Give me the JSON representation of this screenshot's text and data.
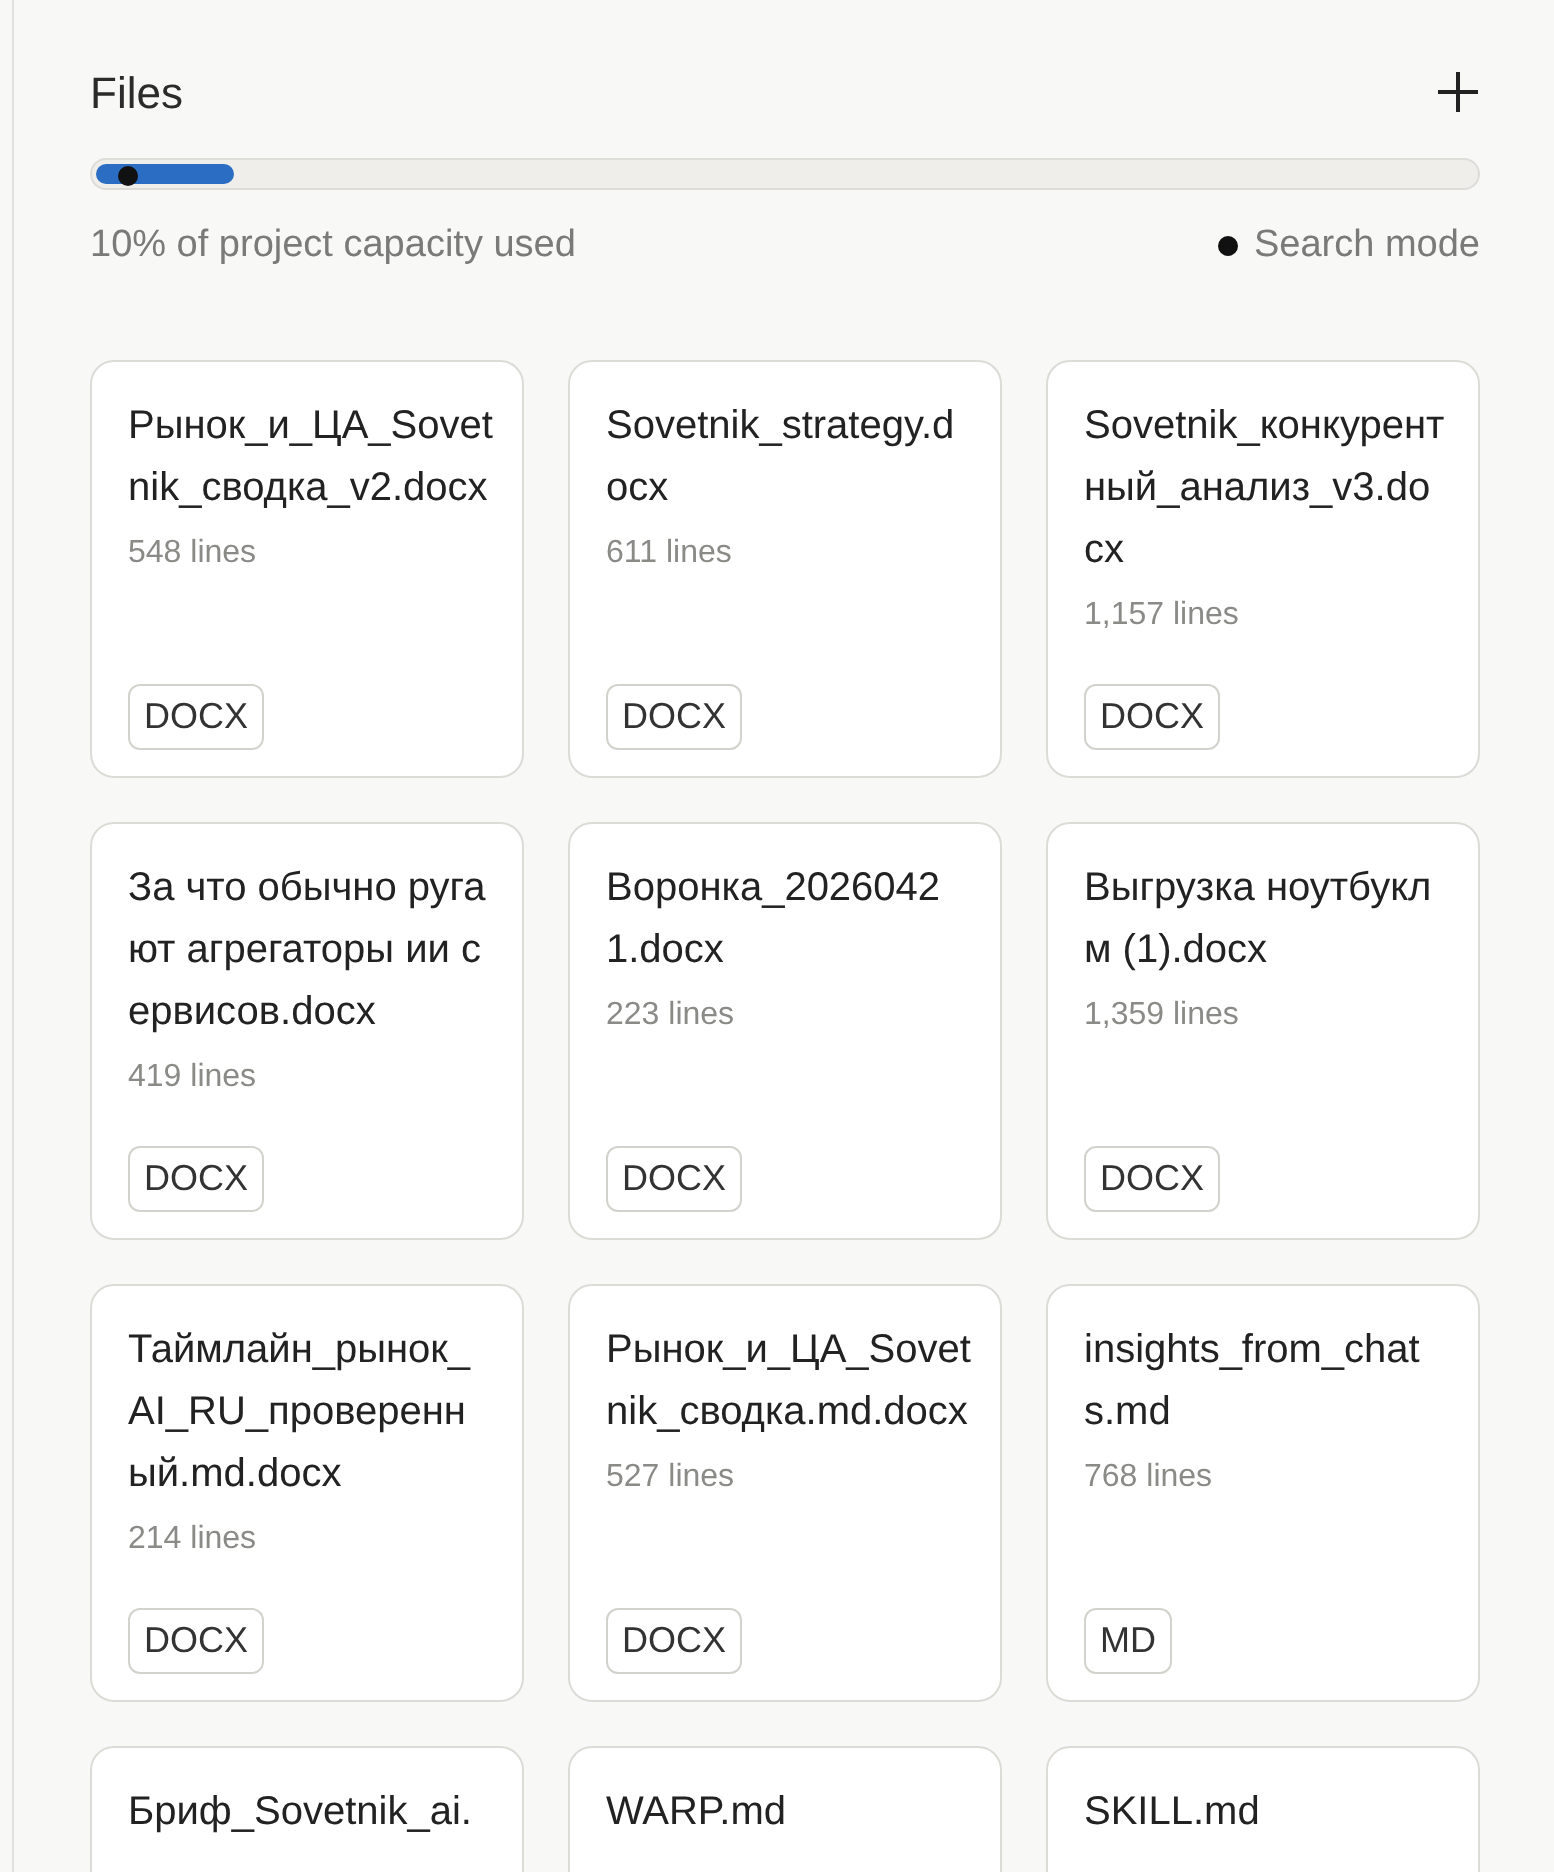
{
  "header": {
    "title": "Files"
  },
  "capacity": {
    "level": 0.1,
    "label": "10% of project capacity used"
  },
  "search_mode": {
    "label": "Search mode"
  },
  "files": [
    {
      "name": "Рынок_и_ЦА_Sovetnik_сводка_v2.docx",
      "lines": "548 lines",
      "type": "DOCX"
    },
    {
      "name": "Sovetnik_strategy.docx",
      "lines": "611 lines",
      "type": "DOCX"
    },
    {
      "name": "Sovetnik_конкурентный_анализ_v3.docx",
      "lines": "1,157 lines",
      "type": "DOCX"
    },
    {
      "name": "За что обычно ругают агрегаторы ии сервисов.docx",
      "lines": "419 lines",
      "type": "DOCX"
    },
    {
      "name": "Воронка_20260421.docx",
      "lines": "223 lines",
      "type": "DOCX"
    },
    {
      "name": "Выгрузка ноутбуклм (1).docx",
      "lines": "1,359 lines",
      "type": "DOCX"
    },
    {
      "name": "Таймлайн_рынок_AI_RU_проверенный.md.docx",
      "lines": "214 lines",
      "type": "DOCX"
    },
    {
      "name": "Рынок_и_ЦА_Sovetnik_сводка.md.docx",
      "lines": "527 lines",
      "type": "DOCX"
    },
    {
      "name": "insights_from_chats.md",
      "lines": "768 lines",
      "type": "MD"
    },
    {
      "name": "Бриф_Sovetnik_ai."
    },
    {
      "name": "WARP.md"
    },
    {
      "name": "SKILL.md"
    }
  ]
}
